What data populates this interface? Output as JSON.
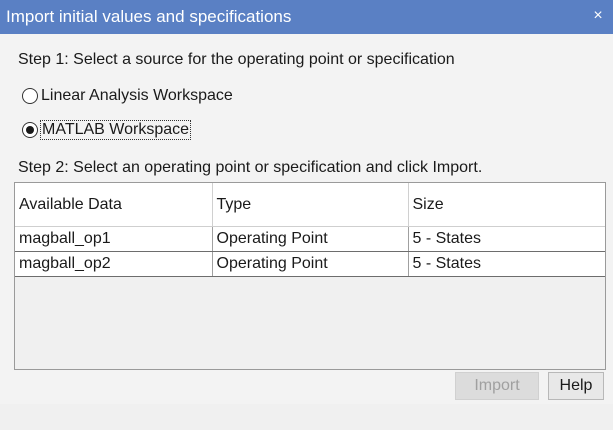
{
  "window": {
    "title": "Import initial values and specifications",
    "close_label": "×"
  },
  "step1": {
    "label": "Step 1: Select a source for the operating point or specification",
    "options": [
      {
        "label": "Linear Analysis Workspace",
        "checked": false
      },
      {
        "label": "MATLAB Workspace",
        "checked": true
      }
    ]
  },
  "step2": {
    "label": "Step 2: Select an operating point or specification and click Import."
  },
  "table": {
    "columns": [
      "Available Data",
      "Type",
      "Size"
    ],
    "rows": [
      [
        "magball_op1",
        "Operating Point",
        "5 - States"
      ],
      [
        "magball_op2",
        "Operating Point",
        "5 - States"
      ]
    ]
  },
  "buttons": {
    "import_label": "Import",
    "import_enabled": false,
    "help_label": "Help"
  },
  "colors": {
    "titlebar": "#5a80c4",
    "background": "#f3f3f3"
  }
}
